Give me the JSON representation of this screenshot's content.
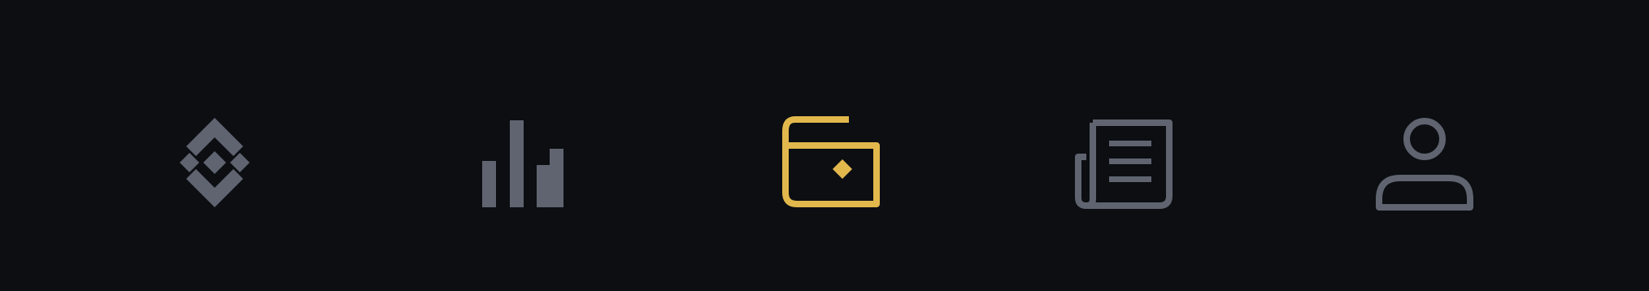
{
  "bottom_nav": {
    "colors": {
      "background": "#0c0e12",
      "inactive": "#5f6470",
      "active": "#e2b84d"
    },
    "tabs": [
      {
        "id": "home",
        "icon": "binance-logo-icon",
        "active": false
      },
      {
        "id": "markets",
        "icon": "bar-chart-icon",
        "active": false
      },
      {
        "id": "wallet",
        "icon": "wallet-icon",
        "active": true
      },
      {
        "id": "news",
        "icon": "newspaper-icon",
        "active": false
      },
      {
        "id": "profile",
        "icon": "user-icon",
        "active": false
      }
    ]
  }
}
